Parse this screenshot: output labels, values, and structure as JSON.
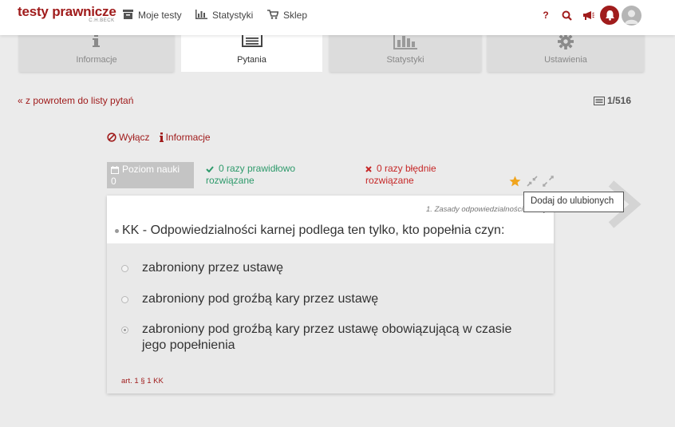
{
  "header": {
    "logo_title": "testy prawnicze",
    "logo_sub": "C.H.BECK",
    "nav": [
      {
        "label": "Moje testy",
        "icon": "archive-icon"
      },
      {
        "label": "Statystyki",
        "icon": "bar-chart-icon"
      },
      {
        "label": "Sklep",
        "icon": "cart-icon"
      }
    ],
    "help_label": "?",
    "accent": "#a01c1c"
  },
  "tabs": [
    {
      "label": "Informacje",
      "icon": "info-icon",
      "active": false
    },
    {
      "label": "Pytania",
      "icon": "list-icon",
      "active": true
    },
    {
      "label": "Statystyki",
      "icon": "bar-chart-icon",
      "active": false
    },
    {
      "label": "Ustawienia",
      "icon": "gear-icon",
      "active": false
    }
  ],
  "back_link": "« z powrotem do listy pytań",
  "counter": "1/516",
  "actions": {
    "disable": "Wyłącz",
    "info": "Informacje"
  },
  "stats": {
    "level_label": "Poziom nauki",
    "level_value": "0",
    "correct_line1": "0 razy prawidłowo",
    "correct_line2": "rozwiązane",
    "wrong_line1": "0 razy błędnie",
    "wrong_line2": "rozwiązane",
    "correct_color": "#2e9a6b",
    "wrong_color": "#c62828"
  },
  "tooltip": "Dodaj do ulubionych",
  "question": {
    "category": "1. Zasady odpowiedzialności karnej",
    "text": "KK - Odpowiedzialności karnej podlega ten tylko, kto popełnia czyn:",
    "answers": [
      {
        "text": "zabroniony przez ustawę",
        "selected": false
      },
      {
        "text": "zabroniony pod groźbą kary przez ustawę",
        "selected": false
      },
      {
        "text": "zabroniony pod groźbą kary przez ustawę obowiązującą w czasie jego popełnienia",
        "selected": true
      }
    ],
    "reference": "art. 1 § 1 KK"
  }
}
